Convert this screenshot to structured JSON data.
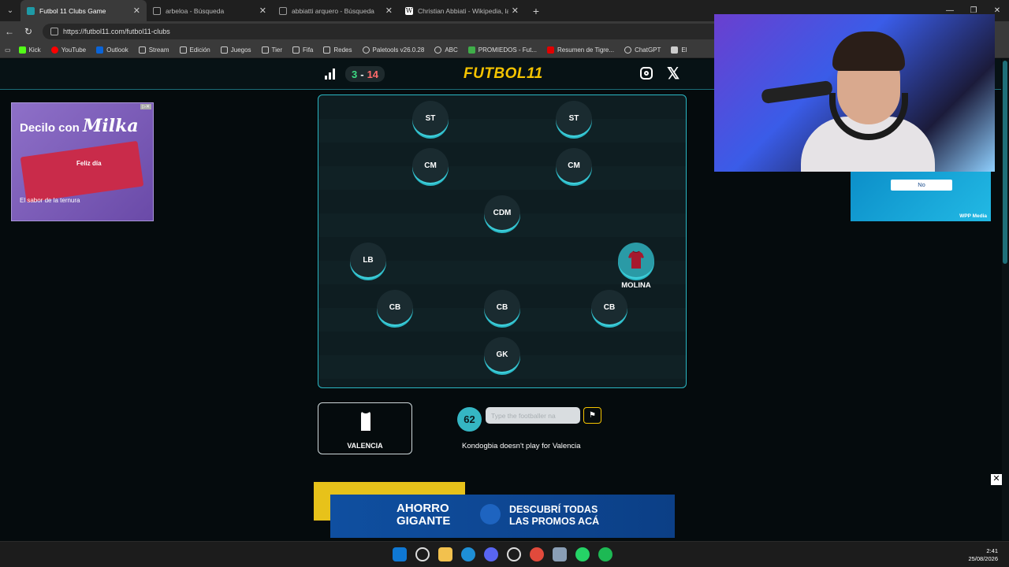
{
  "browser": {
    "tabs": [
      {
        "title": "Futbol 11 Clubs Game",
        "active": true,
        "icon": "futbol11-favicon"
      },
      {
        "title": "arbeloa - Búsqueda",
        "active": false,
        "icon": "search-favicon"
      },
      {
        "title": "abbiatti arquero - Búsqueda",
        "active": false,
        "icon": "search-favicon"
      },
      {
        "title": "Christian Abbiati - Wikipedia, la en",
        "active": false,
        "icon": "wikipedia-favicon"
      }
    ],
    "url": "https://futbol11.com/futbol11-clubs",
    "bookmarks": [
      {
        "label": "Kick",
        "color": "#53fc18"
      },
      {
        "label": "YouTube",
        "color": "#ff0000"
      },
      {
        "label": "Outlook",
        "color": "#0a64d8"
      },
      {
        "label": "Stream",
        "color": "#9a9a9a"
      },
      {
        "label": "Edición",
        "color": "#9a9a9a"
      },
      {
        "label": "Juegos",
        "color": "#9a9a9a"
      },
      {
        "label": "Tier",
        "color": "#9a9a9a"
      },
      {
        "label": "Fifa",
        "color": "#9a9a9a"
      },
      {
        "label": "Redes",
        "color": "#9a9a9a"
      },
      {
        "label": "Paletools v26.0.28",
        "color": "#cfcfcf"
      },
      {
        "label": "ABC",
        "color": "#cfcfcf"
      },
      {
        "label": "PROMIEDOS - Fut...",
        "color": "#3fae49"
      },
      {
        "label": "Resumen de Tigre...",
        "color": "#e00000"
      },
      {
        "label": "ChatGPT",
        "color": "#cfcfcf"
      },
      {
        "label": "El",
        "color": "#cfcfcf"
      }
    ]
  },
  "game": {
    "logo": "FUTBOL11",
    "score": {
      "wins": "3",
      "separator": "-",
      "losses": "14"
    },
    "positions": {
      "st_left": "ST",
      "st_right": "ST",
      "cm_left": "CM",
      "cm_right": "CM",
      "cdm": "CDM",
      "lb": "LB",
      "cb_left": "CB",
      "cb_center": "CB",
      "cb_right": "CB",
      "gk": "GK"
    },
    "filled_player": {
      "name": "MOLINA"
    },
    "club": {
      "name": "VALENCIA"
    },
    "remaining": "62",
    "input": {
      "placeholder": "Type the footballer na",
      "value": ""
    },
    "feedback": "Kondogbia doesn't play for Valencia"
  },
  "ads": {
    "milka_headline": "Decilo con",
    "milka_brand": "Milka",
    "milka_tagline": "El sabor de la ternura",
    "milka_feliz": "Feliz día",
    "carrefour_left": "AHORRO GIGANTE",
    "carrefour_right": "DESCUBRÍ TODAS LAS PROMOS ACÁ"
  },
  "popup": {
    "no_label": "No",
    "brand": "WPP Media"
  },
  "clock": {
    "time": "2:41",
    "date": "25/08/2026"
  },
  "colors": {
    "accent": "#2ab7c4",
    "logo": "#f5c400",
    "win": "#3ddc84",
    "loss": "#ff6b6b"
  }
}
